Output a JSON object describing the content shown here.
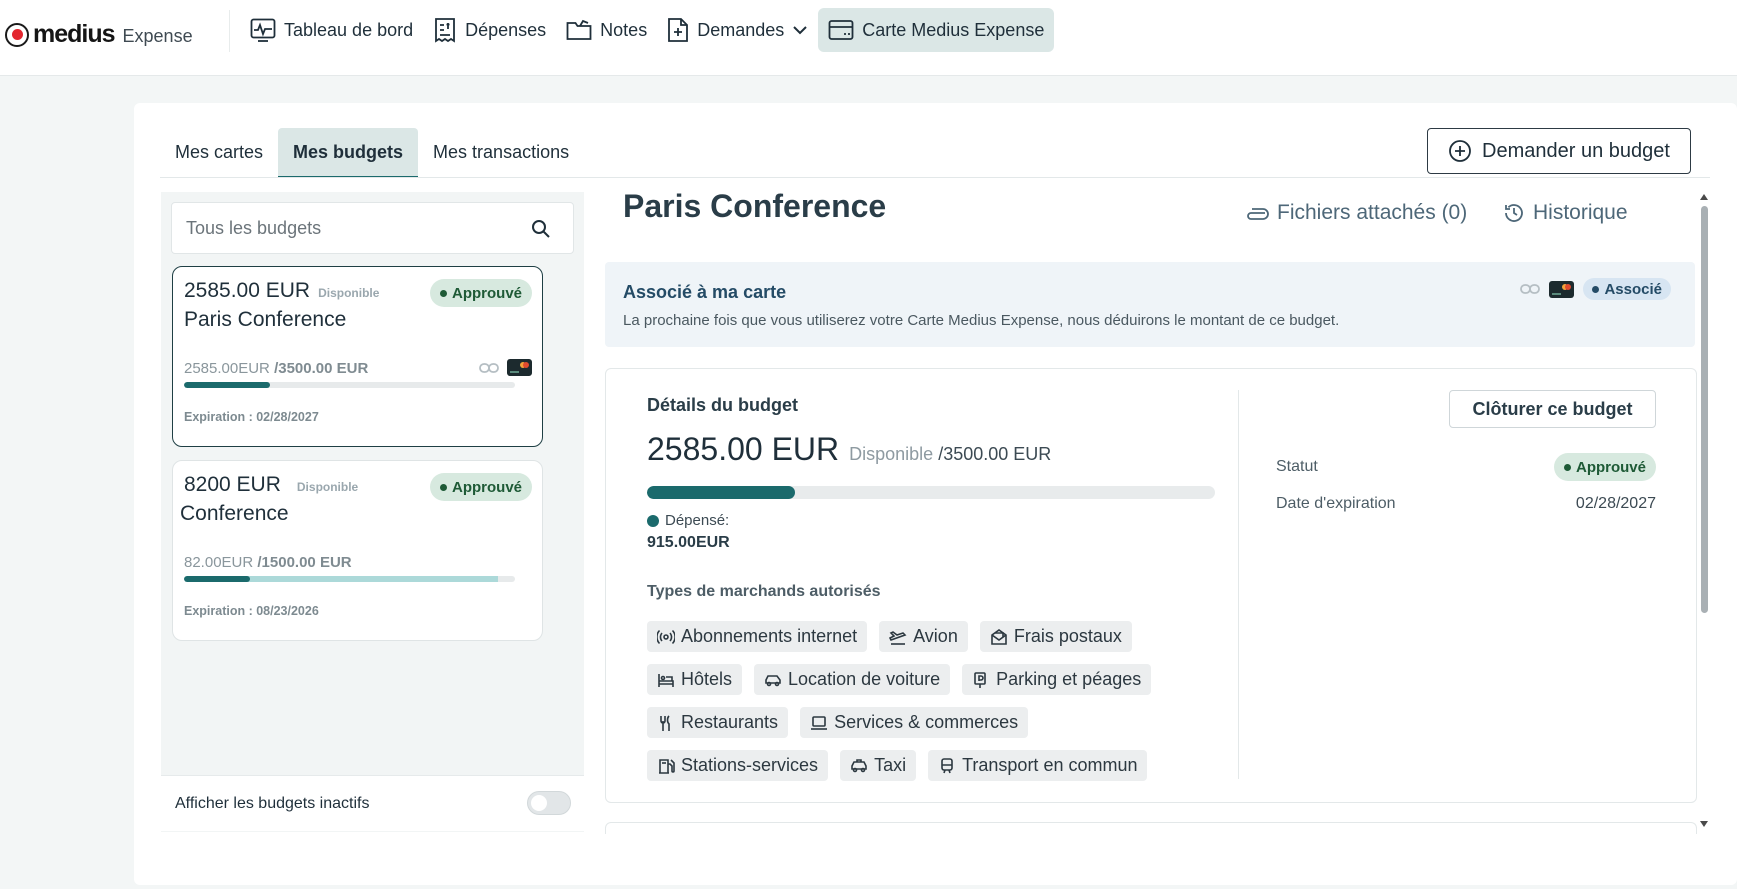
{
  "app": {
    "logo_word": "medius",
    "logo_sub": "Expense"
  },
  "nav": [
    {
      "label": "Tableau de bord",
      "icon": "dashboard-icon"
    },
    {
      "label": "Dépenses",
      "icon": "expenses-icon"
    },
    {
      "label": "Notes",
      "icon": "folder-icon"
    },
    {
      "label": "Demandes",
      "icon": "request-icon"
    },
    {
      "label": "Carte Medius Expense",
      "icon": "credit-card-icon",
      "active": true
    }
  ],
  "tabs": [
    {
      "label": "Mes cartes"
    },
    {
      "label": "Mes budgets",
      "active": true
    },
    {
      "label": "Mes transactions"
    }
  ],
  "request_button": "Demander un budget",
  "search": {
    "placeholder": "Tous les budgets"
  },
  "budgets": [
    {
      "amount": "2585.00 EUR",
      "available_label": "Disponible",
      "status": "Approuvé",
      "name": "Paris Conference",
      "remaining": "2585.00EUR",
      "total": "/3500.00 EUR",
      "spent_fraction": 0.26,
      "remaining_fraction": 0.74,
      "expiration": "Expiration : 02/28/2027"
    },
    {
      "amount": "8200 EUR",
      "available_label": "Disponible",
      "status": "Approuvé",
      "name": "Conference",
      "remaining": "82.00EUR",
      "total": "/1500.00 EUR",
      "spent_fraction": 0.2,
      "remaining_fraction": 0.95,
      "expiration": "Expiration : 08/23/2026"
    }
  ],
  "inactive_toggle": {
    "label": "Afficher les budgets inactifs",
    "on": false
  },
  "detail": {
    "title": "Paris Conference",
    "attachments": "Fichiers attachés (0)",
    "history": "Historique",
    "assoc": {
      "title": "Associé à ma carte",
      "desc": "La prochaine fois que vous utiliserez votre Carte Medius Expense, nous déduirons le montant de ce budget.",
      "badge": "Associé"
    },
    "budget_label": "Détails du budget",
    "amount": "2585.00 EUR",
    "available_label": "Disponible",
    "total": "/3500.00 EUR",
    "spent_fraction": 0.26,
    "spent_label": "Dépensé:",
    "spent_value": "915.00EUR",
    "merchant_types_label": "Types de marchands autorisés",
    "merchant_types": [
      {
        "label": "Abonnements internet",
        "icon": "wifi-icon"
      },
      {
        "label": "Avion",
        "icon": "plane-icon"
      },
      {
        "label": "Frais postaux",
        "icon": "mail-icon"
      },
      {
        "label": "Hôtels",
        "icon": "hotel-icon"
      },
      {
        "label": "Location de voiture",
        "icon": "car-icon"
      },
      {
        "label": "Parking et péages",
        "icon": "parking-icon"
      },
      {
        "label": "Restaurants",
        "icon": "restaurant-icon"
      },
      {
        "label": "Services & commerces",
        "icon": "laptop-icon"
      },
      {
        "label": "Stations-services",
        "icon": "fuel-icon"
      },
      {
        "label": "Taxi",
        "icon": "taxi-icon"
      },
      {
        "label": "Transport en commun",
        "icon": "train-icon"
      }
    ],
    "close_button": "Clôturer ce budget",
    "status_key": "Statut",
    "status_value": "Approuvé",
    "expiration_key": "Date d'expiration",
    "expiration_value": "02/28/2027"
  },
  "colors": {
    "accent": "#1b6a6c",
    "approved_bg": "#d7e9df",
    "associated_bg": "#d7e5f2"
  }
}
